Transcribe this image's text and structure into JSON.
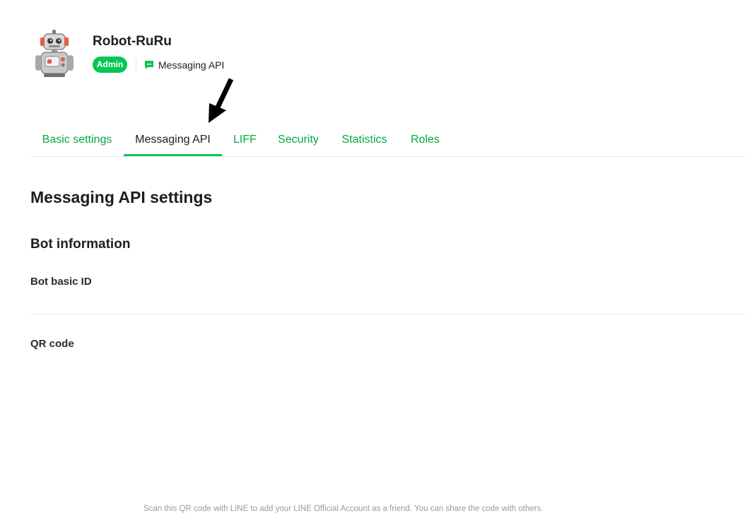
{
  "channel": {
    "name": "Robot-RuRu",
    "role_badge": "Admin",
    "type_label": "Messaging API",
    "avatar_icon": "robot-avatar-icon",
    "type_icon": "chat-bubble-icon"
  },
  "tabs": [
    {
      "label": "Basic settings",
      "active": false
    },
    {
      "label": "Messaging API",
      "active": true
    },
    {
      "label": "LIFF",
      "active": false
    },
    {
      "label": "Security",
      "active": false
    },
    {
      "label": "Statistics",
      "active": false
    },
    {
      "label": "Roles",
      "active": false
    }
  ],
  "page": {
    "title": "Messaging API settings",
    "section_title": "Bot information",
    "bot_basic_id_label": "Bot basic ID",
    "qr_code_label": "QR code",
    "qr_note": "Scan this QR code with LINE to add your LINE Official Account as a friend. You can share the code with others."
  },
  "colors": {
    "accent": "#06c755",
    "tab_text": "#06a83f",
    "text": "#1e1e1e"
  }
}
